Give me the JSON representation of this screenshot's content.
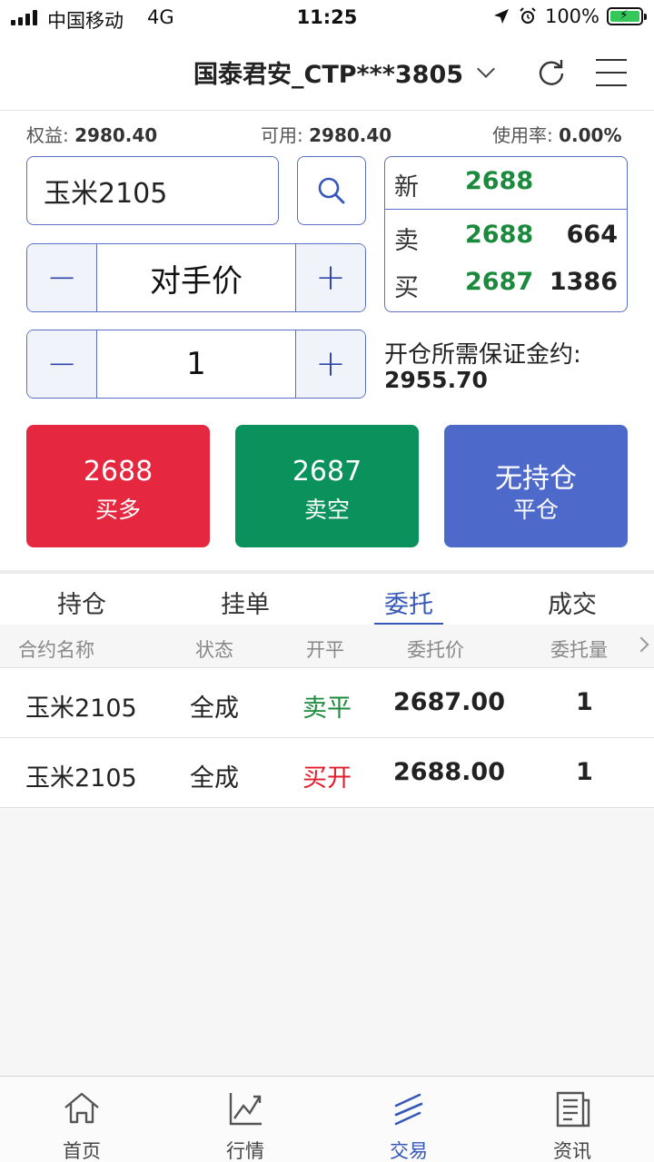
{
  "status_bar": {
    "carrier": "中国移动",
    "network": "4G",
    "time": "11:25",
    "battery": "100%"
  },
  "header": {
    "account": "国泰君安_CTP***3805"
  },
  "summary": {
    "equity_label": "权益:",
    "equity_value": "2980.40",
    "available_label": "可用:",
    "available_value": "2980.40",
    "usage_label": "使用率:",
    "usage_value": "0.00%"
  },
  "order_form": {
    "contract": "玉米2105",
    "price_type": "对手价",
    "quantity": "1"
  },
  "quote": {
    "last_label": "新",
    "last_price": "2688",
    "ask_label": "卖",
    "ask_price": "2688",
    "ask_volume": "664",
    "bid_label": "买",
    "bid_price": "2687",
    "bid_volume": "1386"
  },
  "margin": {
    "label": "开仓所需保证金约:",
    "value": "2955.70"
  },
  "actions": {
    "buy_price": "2688",
    "buy_label": "买多",
    "sell_price": "2687",
    "sell_label": "卖空",
    "close_status": "无持仓",
    "close_label": "平仓"
  },
  "tabs": [
    "持仓",
    "挂单",
    "委托",
    "成交"
  ],
  "active_tab": "委托",
  "table": {
    "columns": [
      "合约名称",
      "状态",
      "开平",
      "委托价",
      "委托量"
    ],
    "rows": [
      {
        "name": "玉米2105",
        "status": "全成",
        "open_close": "卖平",
        "price": "2687.00",
        "qty": "1"
      },
      {
        "name": "玉米2105",
        "status": "全成",
        "open_close": "买开",
        "price": "2688.00",
        "qty": "1"
      }
    ]
  },
  "bottom_nav": [
    {
      "label": "首页",
      "icon": "home-icon"
    },
    {
      "label": "行情",
      "icon": "chart-icon"
    },
    {
      "label": "交易",
      "icon": "trade-icon"
    },
    {
      "label": "资讯",
      "icon": "news-icon"
    }
  ],
  "colors": {
    "accent": "#3557b7",
    "buy": "#e5283f",
    "sell": "#0a915c",
    "close": "#4d69c9",
    "up_green": "#1b8a3c"
  }
}
